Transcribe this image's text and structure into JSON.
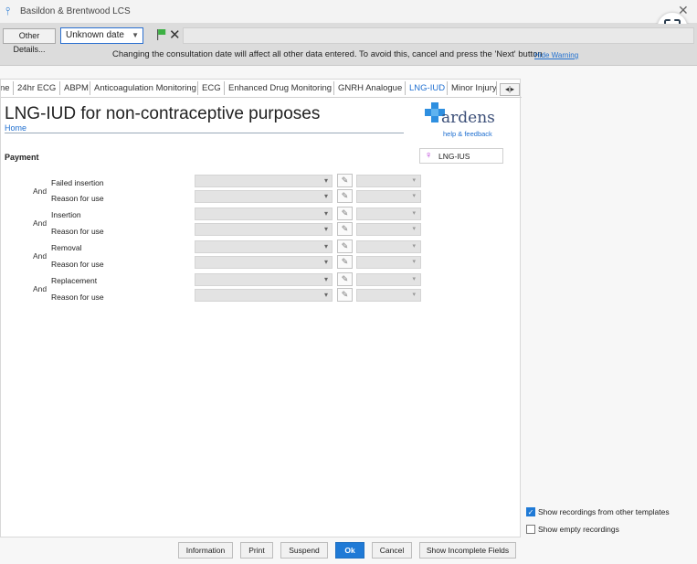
{
  "window": {
    "title": "Basildon & Brentwood LCS"
  },
  "toolbar": {
    "other_details_label": "Other Details...",
    "date_value": "Unknown date",
    "warning_text": "Changing the consultation date will affect all other data entered. To avoid this, cancel and press the 'Next' button",
    "hide_warning_label": "Hide Warning",
    "flag_color": "#3cb043"
  },
  "tabs": [
    {
      "label": "ne"
    },
    {
      "label": "24hr ECG"
    },
    {
      "label": "ABPM"
    },
    {
      "label": "Anticoagulation Monitoring"
    },
    {
      "label": "ECG"
    },
    {
      "label": "Enhanced Drug Monitoring"
    },
    {
      "label": "GNRH Analogue"
    },
    {
      "label": "LNG-IUD",
      "active": true
    },
    {
      "label": "Minor Injury"
    }
  ],
  "tab_scroll_label": "◂|▸",
  "page": {
    "title": "LNG-IUD for non-contraceptive purposes",
    "home_label": "Home",
    "brand": {
      "name": "ardens",
      "help_label": "help & feedback",
      "color": "#3c4f78",
      "cross_color": "#2e8fe0"
    },
    "section_label": "Payment",
    "tag_label": "LNG-IUS",
    "and_label": "And",
    "rows": [
      {
        "label": "Failed insertion"
      },
      {
        "label": "Reason for use"
      },
      {
        "label": "Insertion"
      },
      {
        "label": "Reason for use"
      },
      {
        "label": "Removal"
      },
      {
        "label": "Reason for use"
      },
      {
        "label": "Replacement"
      },
      {
        "label": "Reason for use"
      }
    ]
  },
  "options": {
    "show_recordings_label": "Show recordings from other templates",
    "show_recordings_checked": true,
    "show_empty_label": "Show empty recordings",
    "show_empty_checked": false
  },
  "buttons": {
    "information": "Information",
    "print": "Print",
    "suspend": "Suspend",
    "ok": "Ok",
    "cancel": "Cancel",
    "show_incomplete": "Show Incomplete Fields"
  },
  "accent_color": "#1f7ad6"
}
